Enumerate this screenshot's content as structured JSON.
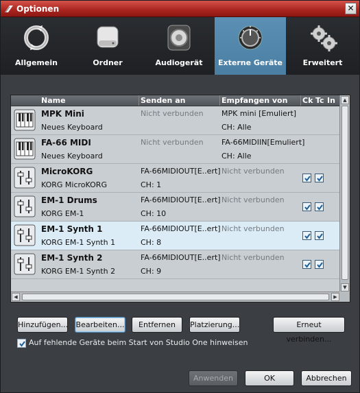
{
  "window": {
    "title": "Optionen",
    "close_glyph": "✕"
  },
  "tabs": [
    {
      "label": "Allgemein",
      "icon": "refresh-icon"
    },
    {
      "label": "Ordner",
      "icon": "drive-icon"
    },
    {
      "label": "Audiogerät",
      "icon": "speaker-icon"
    },
    {
      "label": "Externe Geräte",
      "icon": "knob-icon",
      "active": true
    },
    {
      "label": "Erweitert",
      "icon": "gears-icon"
    }
  ],
  "list": {
    "columns": {
      "name": "Name",
      "send": "Senden an",
      "receive": "Empfangen von",
      "ck": "Ck",
      "tc": "Tc",
      "in": "In"
    },
    "rows": [
      {
        "name": "MPK Mini",
        "type": "Neues Keyboard",
        "send": "Nicht verbunden",
        "send2": "",
        "receive": "MPK mini [Emuliert]",
        "receive2": "CH: Alle",
        "icon": "keyboard-icon",
        "ck": false,
        "tc": false,
        "selected": false
      },
      {
        "name": "FA-66 MIDI",
        "type": "Neues Keyboard",
        "send": "Nicht verbunden",
        "send2": "",
        "receive": "FA-66MIDIIN[Emuliert]",
        "receive2": "CH: Alle",
        "icon": "keyboard-icon",
        "ck": false,
        "tc": false,
        "selected": false
      },
      {
        "name": "MicroKORG",
        "type": "KORG MicroKORG",
        "send": "FA-66MIDIOUT[E..ert]",
        "send2": "CH: 1",
        "receive": "Nicht verbunden",
        "receive2": "",
        "icon": "synth-module-icon",
        "ck": true,
        "tc": true,
        "selected": false
      },
      {
        "name": "EM-1 Drums",
        "type": "KORG EM-1",
        "send": "FA-66MIDIOUT[E..ert]",
        "send2": "CH: 10",
        "receive": "Nicht verbunden",
        "receive2": "",
        "icon": "synth-module-icon",
        "ck": true,
        "tc": true,
        "selected": false
      },
      {
        "name": "EM-1 Synth 1",
        "type": "KORG EM-1 Synth 1",
        "send": "FA-66MIDIOUT[E..ert]",
        "send2": "CH: 8",
        "receive": "Nicht verbunden",
        "receive2": "",
        "icon": "synth-module-icon",
        "ck": true,
        "tc": true,
        "selected": true
      },
      {
        "name": "EM-1 Synth 2",
        "type": "KORG EM-1 Synth 2",
        "send": "FA-66MIDIOUT[E..ert]",
        "send2": "CH: 9",
        "receive": "Nicht verbunden",
        "receive2": "",
        "icon": "synth-module-icon",
        "ck": true,
        "tc": true,
        "selected": false
      }
    ]
  },
  "actions": {
    "add": "Hinzufügen...",
    "edit": "Bearbeiten...",
    "remove": "Entfernen",
    "placement": "Platzierung...",
    "reconnect": "Erneut verbinden..."
  },
  "notify_missing": {
    "label": "Auf fehlende Geräte beim Start von Studio One hinweisen",
    "checked": true
  },
  "footer": {
    "apply": "Anwenden",
    "ok": "OK",
    "cancel": "Abbrechen"
  },
  "colors": {
    "title_bar": "#b3302a",
    "active_tab": "#5289ad",
    "selected_row": "#dcecf6",
    "window_bg": "#3b3f44"
  }
}
